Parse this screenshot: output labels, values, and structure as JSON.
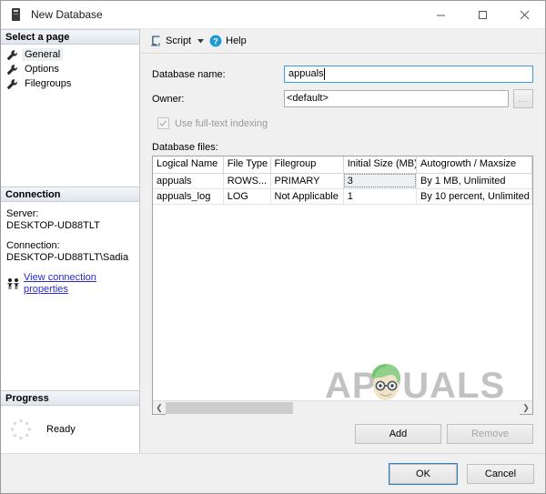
{
  "window": {
    "title": "New Database",
    "icon": "database-server-icon",
    "minimize_label": "Minimize",
    "maximize_label": "Maximize",
    "close_label": "Close"
  },
  "sidebar": {
    "header": "Select a page",
    "items": [
      {
        "label": "General",
        "icon": "wrench-icon",
        "selected": true
      },
      {
        "label": "Options",
        "icon": "wrench-icon",
        "selected": false
      },
      {
        "label": "Filegroups",
        "icon": "wrench-icon",
        "selected": false
      }
    ]
  },
  "connection": {
    "header": "Connection",
    "server_label": "Server:",
    "server_value": "DESKTOP-UD88TLT",
    "connection_label": "Connection:",
    "connection_value": "DESKTOP-UD88TLT\\Sadia",
    "link_text": "View connection properties",
    "link_icon": "connection-people-icon",
    "link_color": "#2a2ad0"
  },
  "progress": {
    "header": "Progress",
    "status": "Ready",
    "spinner_icon": "progress-ring-icon"
  },
  "toolbar": {
    "script_label": "Script",
    "script_icon": "script-icon",
    "caret_icon": "chevron-down-icon",
    "help_label": "Help",
    "help_icon": "help-circle-icon"
  },
  "form": {
    "database_name_label": "Database name:",
    "database_name_value": "appuals",
    "owner_label": "Owner:",
    "owner_value": "<default>",
    "owner_browse_label": "...",
    "fulltext_label": "Use full-text indexing",
    "fulltext_checked": true,
    "fulltext_enabled": false,
    "database_files_label": "Database files:"
  },
  "grid": {
    "columns": [
      "Logical Name",
      "File Type",
      "Filegroup",
      "Initial Size (MB)",
      "Autogrowth / Maxsize"
    ],
    "rows": [
      {
        "logical_name": "appuals",
        "file_type": "ROWS...",
        "filegroup": "PRIMARY",
        "initial_size": "3",
        "autogrowth": "By 1 MB, Unlimited",
        "focused_cell": "initial_size"
      },
      {
        "logical_name": "appuals_log",
        "file_type": "LOG",
        "filegroup": "Not Applicable",
        "initial_size": "1",
        "autogrowth": "By 10 percent, Unlimited",
        "focused_cell": ""
      }
    ],
    "scroll_left_icon": "chevron-left-icon",
    "scroll_right_icon": "chevron-right-icon"
  },
  "actions": {
    "add_label": "Add",
    "remove_label": "Remove",
    "remove_enabled": false,
    "ok_label": "OK",
    "cancel_label": "Cancel"
  },
  "watermark": {
    "text": "APPUALS",
    "mascot_icon": "appuals-mascot-icon"
  },
  "colors": {
    "focus_blue": "#3d9ae0",
    "link_blue": "#2a2ad0",
    "help_blue": "#1c9ad6",
    "panel_header": "#dfe6ee"
  }
}
